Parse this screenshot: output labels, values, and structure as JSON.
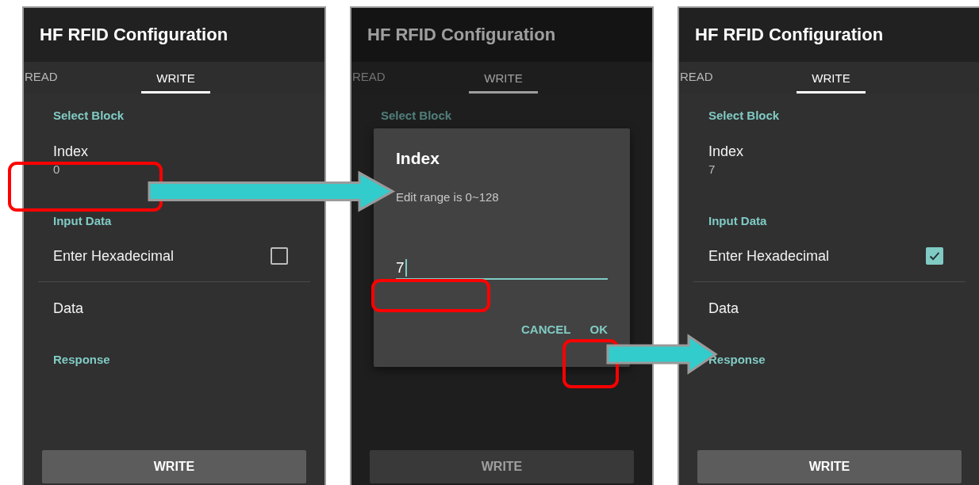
{
  "screens": [
    {
      "title": "HF RFID Configuration",
      "dimmed": false,
      "tabs": [
        {
          "label": "READ",
          "selected": false
        },
        {
          "label": "WRITE",
          "selected": true
        }
      ],
      "items": [
        {
          "kind": "header",
          "label": "Select Block"
        },
        {
          "kind": "value",
          "label": "Index",
          "value": "0"
        },
        {
          "kind": "header",
          "label": "Input Data"
        },
        {
          "kind": "checkbox",
          "label": "Enter Hexadecimal",
          "checked": false
        },
        {
          "kind": "plain",
          "label": "Data"
        },
        {
          "kind": "header",
          "label": "Response"
        }
      ],
      "button": "WRITE"
    },
    {
      "title": "HF RFID Configuration",
      "dimmed": true,
      "tabs": [
        {
          "label": "READ",
          "selected": false
        },
        {
          "label": "WRITE",
          "selected": true
        }
      ],
      "items": [
        {
          "kind": "header",
          "label": "Select Block"
        }
      ],
      "button": "WRITE",
      "dialog": {
        "title": "Index",
        "message": "Edit range is 0~128",
        "value": "7",
        "buttons": [
          "CANCEL",
          "OK"
        ]
      }
    },
    {
      "title": "HF RFID Configuration",
      "dimmed": false,
      "tabs": [
        {
          "label": "READ",
          "selected": false
        },
        {
          "label": "WRITE",
          "selected": true
        }
      ],
      "items": [
        {
          "kind": "header",
          "label": "Select Block"
        },
        {
          "kind": "value",
          "label": "Index",
          "value": "7"
        },
        {
          "kind": "header",
          "label": "Input Data"
        },
        {
          "kind": "checkbox",
          "label": "Enter Hexadecimal",
          "checked": true
        },
        {
          "kind": "plain",
          "label": "Data"
        },
        {
          "kind": "header",
          "label": "Response"
        }
      ],
      "button": "WRITE"
    }
  ]
}
